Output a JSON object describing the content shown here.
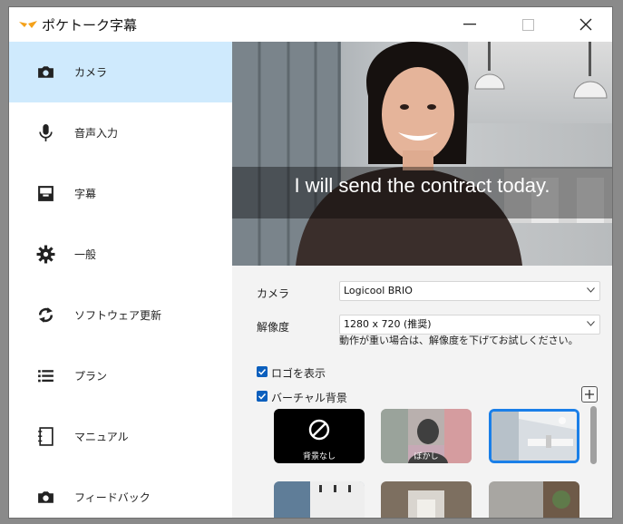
{
  "app": {
    "title": "ポケトーク字幕"
  },
  "sidebar": {
    "items": [
      {
        "label": "カメラ",
        "icon": "camera-icon"
      },
      {
        "label": "音声入力",
        "icon": "microphone-icon"
      },
      {
        "label": "字幕",
        "icon": "subtitles-icon"
      },
      {
        "label": "一般",
        "icon": "gear-icon"
      },
      {
        "label": "ソフトウェア更新",
        "icon": "update-icon"
      },
      {
        "label": "プラン",
        "icon": "list-icon"
      },
      {
        "label": "マニュアル",
        "icon": "manual-icon"
      },
      {
        "label": "フィードバック",
        "icon": "camera-icon"
      }
    ]
  },
  "preview": {
    "subtitle": "I will send the contract today."
  },
  "settings": {
    "camera_label": "カメラ",
    "camera_value": "Logicool BRIO",
    "resolution_label": "解像度",
    "resolution_value": "1280 x 720 (推奨)",
    "resolution_hint": "動作が重い場合は、解像度を下げてお試しください。",
    "show_logo_label": "ロゴを表示",
    "virtual_bg_label": "バーチャル背景",
    "bg_none_label": "背景なし",
    "bg_blur_label": "ぼかし"
  },
  "colors": {
    "accent": "#0b5fbd",
    "sidebar_active": "#cfeafd",
    "selected_border": "#1a7fe8"
  }
}
